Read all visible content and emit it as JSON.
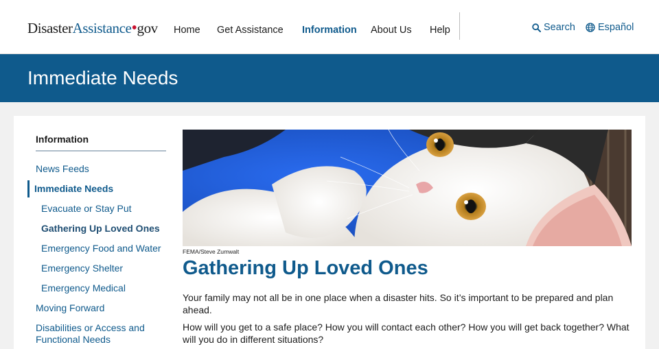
{
  "header": {
    "logo": {
      "part1": "Disaster",
      "part2": "Assistance",
      "dot": "•",
      "part3": "gov"
    },
    "nav": [
      {
        "label": "Home",
        "active": false
      },
      {
        "label": "Get Assistance",
        "active": false
      },
      {
        "label": "Information",
        "active": true
      },
      {
        "label": "About Us",
        "active": false
      },
      {
        "label": "Help",
        "active": false
      }
    ],
    "search_label": "Search",
    "language_label": "Español",
    "search_icon": "search-icon",
    "language_icon": "globe-icon"
  },
  "hero": {
    "title": "Immediate Needs"
  },
  "sidebar": {
    "title": "Information",
    "items": [
      {
        "label": "News Feeds",
        "level": 1,
        "current": false
      },
      {
        "label": "Immediate Needs",
        "level": 1,
        "current": true
      },
      {
        "label": "Evacuate or Stay Put",
        "level": 2,
        "current": false
      },
      {
        "label": "Gathering Up Loved Ones",
        "level": 2,
        "current": true
      },
      {
        "label": "Emergency Food and Water",
        "level": 2,
        "current": false
      },
      {
        "label": "Emergency Shelter",
        "level": 2,
        "current": false
      },
      {
        "label": "Emergency Medical",
        "level": 2,
        "current": false
      },
      {
        "label": "Moving Forward",
        "level": 1,
        "current": false
      },
      {
        "label": "Disabilities or Access and Functional Needs",
        "level": 1,
        "current": false
      }
    ]
  },
  "main": {
    "photo_caption": "FEMA/Steve Zumwalt",
    "title": "Gathering Up Loved Ones",
    "paragraphs": [
      "Your family may not all be in one place when a disaster hits. So it’s important to be prepared and plan ahead.",
      "How will you get to a safe place? How you will contact each other? How you will get back together? What will you do in different situations?"
    ]
  },
  "colors": {
    "brand": "#0f5a8c",
    "accent_red": "#c8102e",
    "background": "#f1f1f1"
  }
}
